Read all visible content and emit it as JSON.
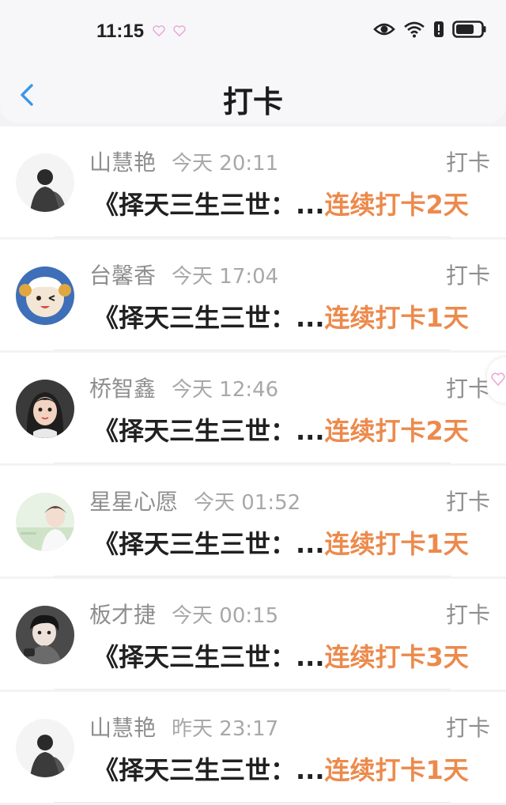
{
  "status_bar": {
    "time": "11:15",
    "icons": [
      "heart-icon",
      "heart-icon",
      "eye-icon",
      "wifi-icon",
      "alert-icon",
      "battery-icon"
    ]
  },
  "header": {
    "title": "打卡",
    "back_icon": "chevron-left-icon"
  },
  "colors": {
    "accent": "#ec8a4c",
    "back": "#3a97e8",
    "muted": "#8e8e8e"
  },
  "items": [
    {
      "name": "山慧艳",
      "time": "今天 20:11",
      "type": "打卡",
      "book": "《择天三生三世：...",
      "streak": "连续打卡2天"
    },
    {
      "name": "台馨香",
      "time": "今天 17:04",
      "type": "打卡",
      "book": "《择天三生三世：...",
      "streak": "连续打卡1天"
    },
    {
      "name": "桥智鑫",
      "time": "今天 12:46",
      "type": "打卡",
      "book": "《择天三生三世：...",
      "streak": "连续打卡2天"
    },
    {
      "name": "星星心愿",
      "time": "今天 01:52",
      "type": "打卡",
      "book": "《择天三生三世：...",
      "streak": "连续打卡1天"
    },
    {
      "name": "板才捷",
      "time": "今天 00:15",
      "type": "打卡",
      "book": "《择天三生三世：...",
      "streak": "连续打卡3天"
    },
    {
      "name": "山慧艳",
      "time": "昨天 23:17",
      "type": "打卡",
      "book": "《择天三生三世：...",
      "streak": "连续打卡1天"
    }
  ]
}
